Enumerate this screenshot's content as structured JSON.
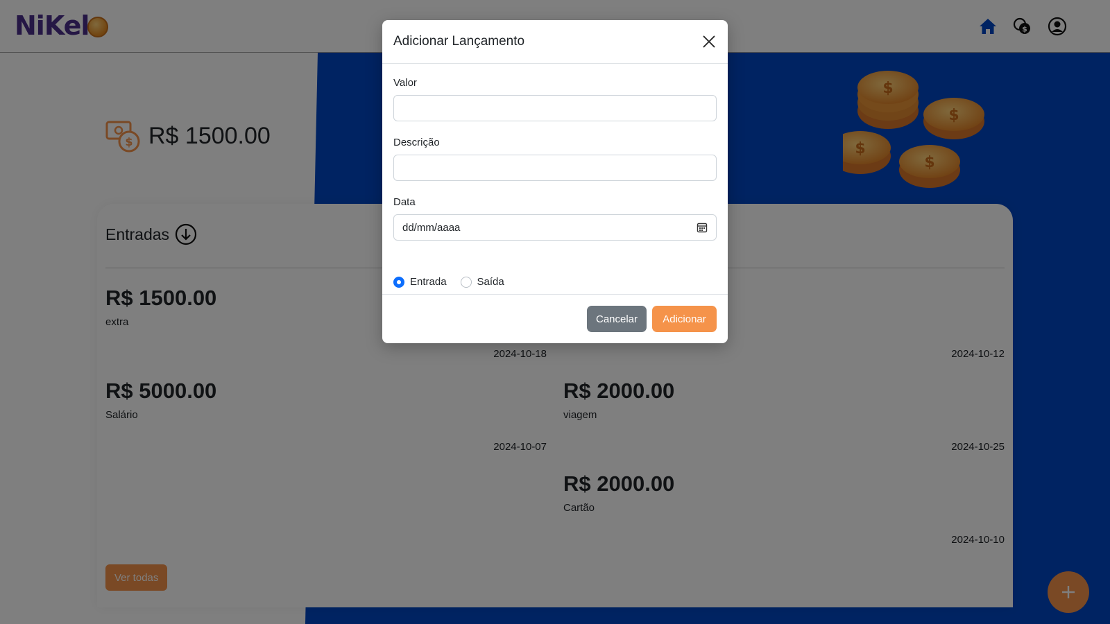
{
  "brand": {
    "logo_text": "NiKel"
  },
  "nav": {
    "icons": [
      "home-icon",
      "transactions-icon",
      "user-account-icon"
    ]
  },
  "balance": {
    "value": "R$ 1500.00"
  },
  "card": {
    "title": "Entradas",
    "entries": [
      {
        "value": "R$ 1500.00",
        "description": "extra",
        "date": "2024-10-18"
      },
      {
        "value": "",
        "description": "",
        "date": "2024-10-12"
      },
      {
        "value": "R$ 5000.00",
        "description": "Salário",
        "date": "2024-10-07"
      },
      {
        "value": "R$ 2000.00",
        "description": "viagem",
        "date": "2024-10-25"
      },
      {
        "value": "R$ 2000.00",
        "description": "Cartão",
        "date": "2024-10-10"
      }
    ],
    "see_all_label": "Ver todas"
  },
  "modal": {
    "title": "Adicionar Lançamento",
    "fields": {
      "value_label": "Valor",
      "value_input": "",
      "description_label": "Descrição",
      "description_input": "",
      "date_label": "Data",
      "date_placeholder": "dd/mm/aaaa"
    },
    "radios": [
      {
        "label": "Entrada",
        "checked": true
      },
      {
        "label": "Saída",
        "checked": false
      }
    ],
    "cancel_label": "Cancelar",
    "add_label": "Adicionar"
  },
  "colors": {
    "accent": "#f5934a",
    "brand_blue": "#0047c4",
    "primary": "#0d6efd",
    "secondary": "#6c757d"
  }
}
